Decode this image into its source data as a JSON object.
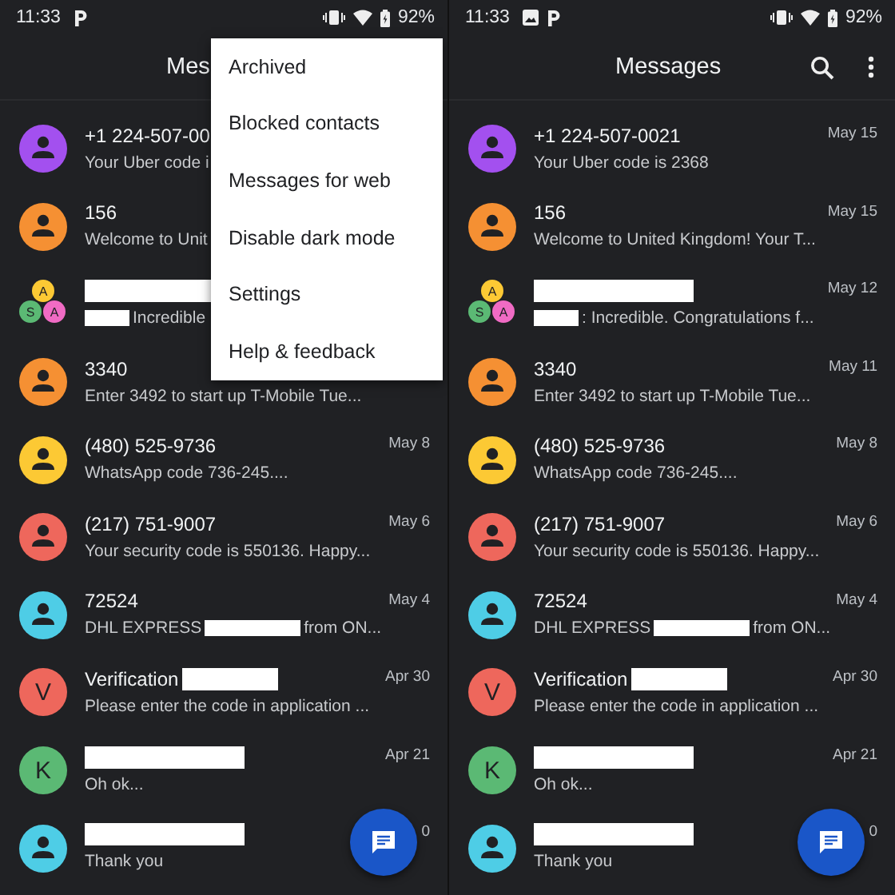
{
  "phones": [
    {
      "status_bar": {
        "time": "11:33",
        "notifications": [
          {
            "kind": "parking"
          }
        ],
        "battery": "92%"
      },
      "title": "Mes",
      "menu": [
        {
          "label": "Archived"
        },
        {
          "label": "Blocked contacts"
        },
        {
          "label": "Messages for web"
        },
        {
          "label": "Disable dark mode"
        },
        {
          "label": "Settings"
        },
        {
          "label": "Help & feedback"
        }
      ],
      "conversations": [
        {
          "avatar": {
            "kind": "person",
            "color": "#a350ef"
          },
          "name": [
            {
              "kind": "text",
              "text": "+1 224-507-00"
            }
          ],
          "preview": [
            {
              "kind": "text",
              "text": "Your Uber code i"
            }
          ]
        },
        {
          "avatar": {
            "kind": "person",
            "color": "#f59033"
          },
          "name": [
            {
              "kind": "text",
              "text": "156"
            }
          ],
          "preview": [
            {
              "kind": "text",
              "text": "Welcome to Unit"
            }
          ]
        },
        {
          "avatar": {
            "kind": "group",
            "members": [
              {
                "letter": "A",
                "color": "#fcc934"
              },
              {
                "letter": "S",
                "color": "#5bb974"
              },
              {
                "letter": "A",
                "color": "#f06bc4"
              }
            ]
          },
          "name": [
            {
              "kind": "redaction"
            }
          ],
          "preview": [
            {
              "kind": "redaction"
            },
            {
              "kind": "text",
              "text": "Incredible"
            }
          ]
        },
        {
          "avatar": {
            "kind": "person",
            "color": "#f59033"
          },
          "name": [
            {
              "kind": "text",
              "text": "3340"
            }
          ],
          "preview": [
            {
              "kind": "text",
              "text": "Enter 3492 to start up T-Mobile Tue..."
            }
          ]
        },
        {
          "avatar": {
            "kind": "person",
            "color": "#fcc934"
          },
          "name": [
            {
              "kind": "text",
              "text": "(480) 525-9736"
            }
          ],
          "preview": [
            {
              "kind": "text",
              "text": "WhatsApp code 736-245...."
            }
          ],
          "date": "May 8"
        },
        {
          "avatar": {
            "kind": "person",
            "color": "#ee675c"
          },
          "name": [
            {
              "kind": "text",
              "text": "(217) 751-9007"
            }
          ],
          "preview": [
            {
              "kind": "text",
              "text": "Your security code is 550136. Happy..."
            }
          ],
          "date": "May 6"
        },
        {
          "avatar": {
            "kind": "person",
            "color": "#4ecde6"
          },
          "name": [
            {
              "kind": "text",
              "text": "72524"
            }
          ],
          "preview": [
            {
              "kind": "text",
              "text": "DHL EXPRESS"
            },
            {
              "kind": "redaction"
            },
            {
              "kind": "text",
              "text": "from ON..."
            }
          ],
          "date": "May 4"
        },
        {
          "avatar": {
            "kind": "letter",
            "letter": "V",
            "color": "#ee675c"
          },
          "name": [
            {
              "kind": "text",
              "text": "Verification"
            },
            {
              "kind": "redaction"
            }
          ],
          "preview": [
            {
              "kind": "text",
              "text": "Please enter the code in application ..."
            }
          ],
          "date": "Apr 30"
        },
        {
          "avatar": {
            "kind": "letter",
            "letter": "K",
            "color": "#5bb974"
          },
          "name": [
            {
              "kind": "redaction"
            }
          ],
          "preview": [
            {
              "kind": "text",
              "text": "Oh ok..."
            }
          ],
          "date": "Apr 21"
        },
        {
          "avatar": {
            "kind": "person",
            "color": "#4ecde6"
          },
          "name": [
            {
              "kind": "redaction"
            }
          ],
          "preview": [
            {
              "kind": "text",
              "text": "Thank you"
            }
          ],
          "date": "0"
        }
      ]
    },
    {
      "status_bar": {
        "time": "11:33",
        "notifications": [
          {
            "kind": "image"
          },
          {
            "kind": "parking"
          }
        ],
        "battery": "92%"
      },
      "title": "Messages",
      "actions": [
        {
          "kind": "search"
        },
        {
          "kind": "more"
        }
      ],
      "conversations": [
        {
          "avatar": {
            "kind": "person",
            "color": "#a350ef"
          },
          "name": [
            {
              "kind": "text",
              "text": "+1 224-507-0021"
            }
          ],
          "preview": [
            {
              "kind": "text",
              "text": "Your Uber code is 2368"
            }
          ],
          "date": "May 15"
        },
        {
          "avatar": {
            "kind": "person",
            "color": "#f59033"
          },
          "name": [
            {
              "kind": "text",
              "text": "156"
            }
          ],
          "preview": [
            {
              "kind": "text",
              "text": "Welcome to United Kingdom! Your T..."
            }
          ],
          "date": "May 15"
        },
        {
          "avatar": {
            "kind": "group",
            "members": [
              {
                "letter": "A",
                "color": "#fcc934"
              },
              {
                "letter": "S",
                "color": "#5bb974"
              },
              {
                "letter": "A",
                "color": "#f06bc4"
              }
            ]
          },
          "name": [
            {
              "kind": "redaction"
            }
          ],
          "preview": [
            {
              "kind": "redaction"
            },
            {
              "kind": "text",
              "text": ": Incredible. Congratulations f..."
            }
          ],
          "date": "May 12"
        },
        {
          "avatar": {
            "kind": "person",
            "color": "#f59033"
          },
          "name": [
            {
              "kind": "text",
              "text": "3340"
            }
          ],
          "preview": [
            {
              "kind": "text",
              "text": "Enter 3492 to start up T-Mobile Tue..."
            }
          ],
          "date": "May 11"
        },
        {
          "avatar": {
            "kind": "person",
            "color": "#fcc934"
          },
          "name": [
            {
              "kind": "text",
              "text": "(480) 525-9736"
            }
          ],
          "preview": [
            {
              "kind": "text",
              "text": "WhatsApp code 736-245...."
            }
          ],
          "date": "May 8"
        },
        {
          "avatar": {
            "kind": "person",
            "color": "#ee675c"
          },
          "name": [
            {
              "kind": "text",
              "text": "(217) 751-9007"
            }
          ],
          "preview": [
            {
              "kind": "text",
              "text": "Your security code is 550136. Happy..."
            }
          ],
          "date": "May 6"
        },
        {
          "avatar": {
            "kind": "person",
            "color": "#4ecde6"
          },
          "name": [
            {
              "kind": "text",
              "text": "72524"
            }
          ],
          "preview": [
            {
              "kind": "text",
              "text": "DHL EXPRESS"
            },
            {
              "kind": "redaction"
            },
            {
              "kind": "text",
              "text": "from ON..."
            }
          ],
          "date": "May 4"
        },
        {
          "avatar": {
            "kind": "letter",
            "letter": "V",
            "color": "#ee675c"
          },
          "name": [
            {
              "kind": "text",
              "text": "Verification"
            },
            {
              "kind": "redaction"
            }
          ],
          "preview": [
            {
              "kind": "text",
              "text": "Please enter the code in application ..."
            }
          ],
          "date": "Apr 30"
        },
        {
          "avatar": {
            "kind": "letter",
            "letter": "K",
            "color": "#5bb974"
          },
          "name": [
            {
              "kind": "redaction"
            }
          ],
          "preview": [
            {
              "kind": "text",
              "text": "Oh ok..."
            }
          ],
          "date": "Apr 21"
        },
        {
          "avatar": {
            "kind": "person",
            "color": "#4ecde6"
          },
          "name": [
            {
              "kind": "redaction"
            }
          ],
          "preview": [
            {
              "kind": "text",
              "text": "Thank you"
            }
          ],
          "date": "0"
        }
      ]
    }
  ]
}
